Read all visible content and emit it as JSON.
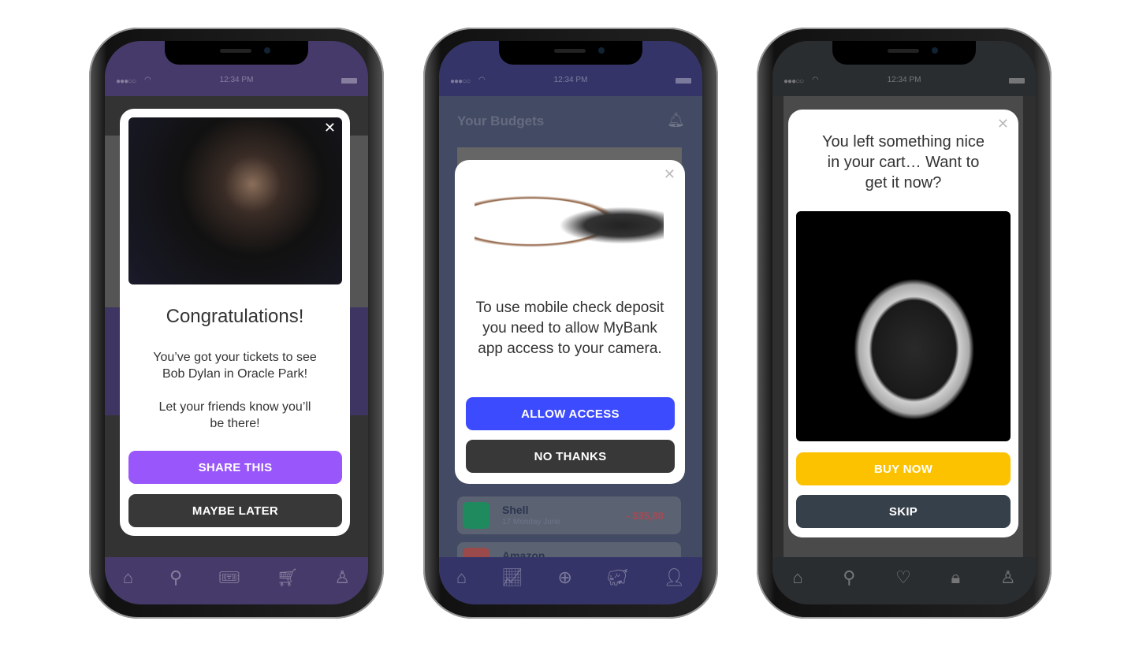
{
  "status_time": "12:34 PM",
  "phone1": {
    "bg": "#463a6a",
    "modal": {
      "title": "Congratulations!",
      "body1": "You’ve got your tickets to see Bob Dylan in Oracle Park!",
      "body2": "Let your friends know you’ll be there!",
      "primary": "SHARE THIS",
      "secondary": "MAYBE LATER",
      "primary_color": "#9956fb",
      "secondary_color": "#383838"
    },
    "tabs": [
      "home-icon",
      "search-icon",
      "ticket-icon",
      "cart-icon",
      "user-icon"
    ]
  },
  "phone2": {
    "bg": "#353468",
    "header": {
      "title": "Your Budgets"
    },
    "transactions": [
      {
        "name": "Shell",
        "date": "17 Monday June",
        "amount": "- $35,88"
      },
      {
        "name": "Amazon"
      }
    ],
    "modal": {
      "body": "To use mobile check deposit you need to allow MyBank app access to your camera.",
      "primary": "ALLOW ACCESS",
      "secondary": "NO THANKS",
      "primary_color": "#3d4bff",
      "secondary_color": "#383838"
    },
    "tabs": [
      "home-icon",
      "chart-icon",
      "add-icon",
      "piggy-bank-icon",
      "user-icon"
    ]
  },
  "phone3": {
    "bg": "#2a2d30",
    "modal": {
      "title": "You left something nice in your cart… Want to get it now?",
      "primary": "BUY NOW",
      "secondary": "SKIP",
      "primary_color": "#fcc200",
      "secondary_color": "#36404a"
    },
    "tabs": [
      "home-icon",
      "search-icon",
      "heart-icon",
      "bag-icon",
      "user-icon"
    ]
  }
}
